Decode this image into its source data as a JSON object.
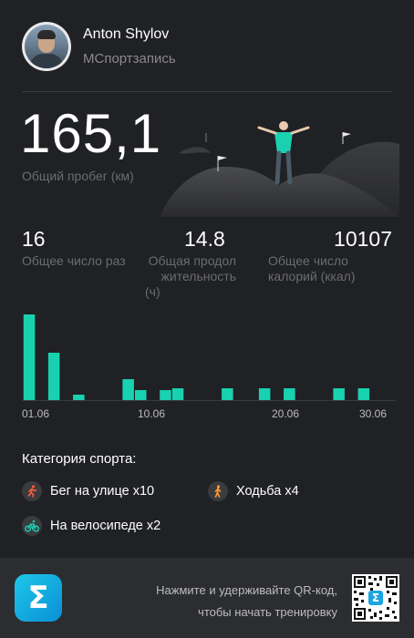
{
  "profile": {
    "name": "Anton Shylov",
    "subtitle": "МСпортзапись"
  },
  "total": {
    "value": "165,1",
    "label": "Общий пробег (км)"
  },
  "stats": [
    {
      "value": "16",
      "label_line1": "Общее число раз",
      "label_line2": ""
    },
    {
      "value": "14.8",
      "label_line1": "Общая продол",
      "label_line2": "жительность",
      "label_line3": "(ч)"
    },
    {
      "value": "10107",
      "label_line1": "Общее число",
      "label_line2": "калорий (ккал)"
    }
  ],
  "chart_data": {
    "type": "bar",
    "days": [
      1,
      3,
      5,
      9,
      10,
      12,
      13,
      17,
      20,
      22,
      26,
      28
    ],
    "values": [
      9.5,
      5.3,
      0.7,
      2.4,
      1.2,
      1.2,
      1.4,
      1.4,
      1.4,
      1.4,
      1.4,
      1.4
    ],
    "x_tick_labels": [
      "01.06",
      "10.06",
      "20.06",
      "30.06"
    ],
    "x_range": [
      1,
      30
    ],
    "bar_color": "#19d1b1",
    "grid": false
  },
  "categories": {
    "title": "Категория спорта:",
    "items": [
      {
        "label": "Бег на улице x10",
        "icon": "running-icon",
        "color": "#ff5a3c"
      },
      {
        "label": "Ходьба x4",
        "icon": "walking-icon",
        "color": "#ff9b2f"
      },
      {
        "label": "На велосипеде x2",
        "icon": "cycling-icon",
        "color": "#19d1b1"
      }
    ]
  },
  "footer": {
    "line1": "Нажмите и удерживайте QR-код,",
    "line2": "чтобы начать тренировку"
  },
  "colors": {
    "accent": "#19d1b1",
    "background": "#202124",
    "footer_bg": "#2c2d30"
  }
}
